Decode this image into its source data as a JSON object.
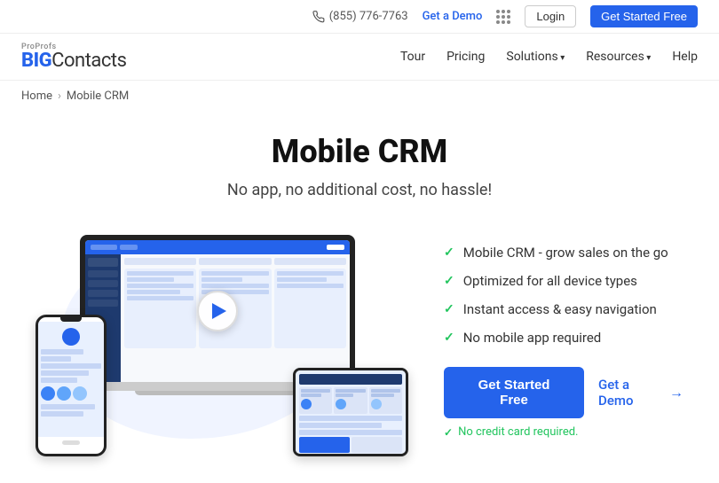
{
  "topbar": {
    "phone": "(855) 776-7763",
    "demo_label": "Get a Demo",
    "login_label": "Login",
    "started_label": "Get Started Free"
  },
  "navbar": {
    "logo_top": "ProProfs",
    "logo_main": "BIG",
    "logo_sub": "Contacts",
    "links": [
      {
        "label": "Tour",
        "has_arrow": false
      },
      {
        "label": "Pricing",
        "has_arrow": false
      },
      {
        "label": "Solutions",
        "has_arrow": true
      },
      {
        "label": "Resources",
        "has_arrow": true
      },
      {
        "label": "Help",
        "has_arrow": false
      }
    ]
  },
  "breadcrumb": {
    "home": "Home",
    "current": "Mobile CRM"
  },
  "hero": {
    "title": "Mobile CRM",
    "subtitle": "No app, no additional cost, no hassle!"
  },
  "features": {
    "items": [
      "Mobile CRM - grow sales on the go",
      "Optimized for all device types",
      "Instant access & easy navigation",
      "No mobile app required"
    ]
  },
  "cta": {
    "primary_label": "Get Started Free",
    "demo_label": "Get a Demo",
    "no_cc": "No credit card required."
  }
}
